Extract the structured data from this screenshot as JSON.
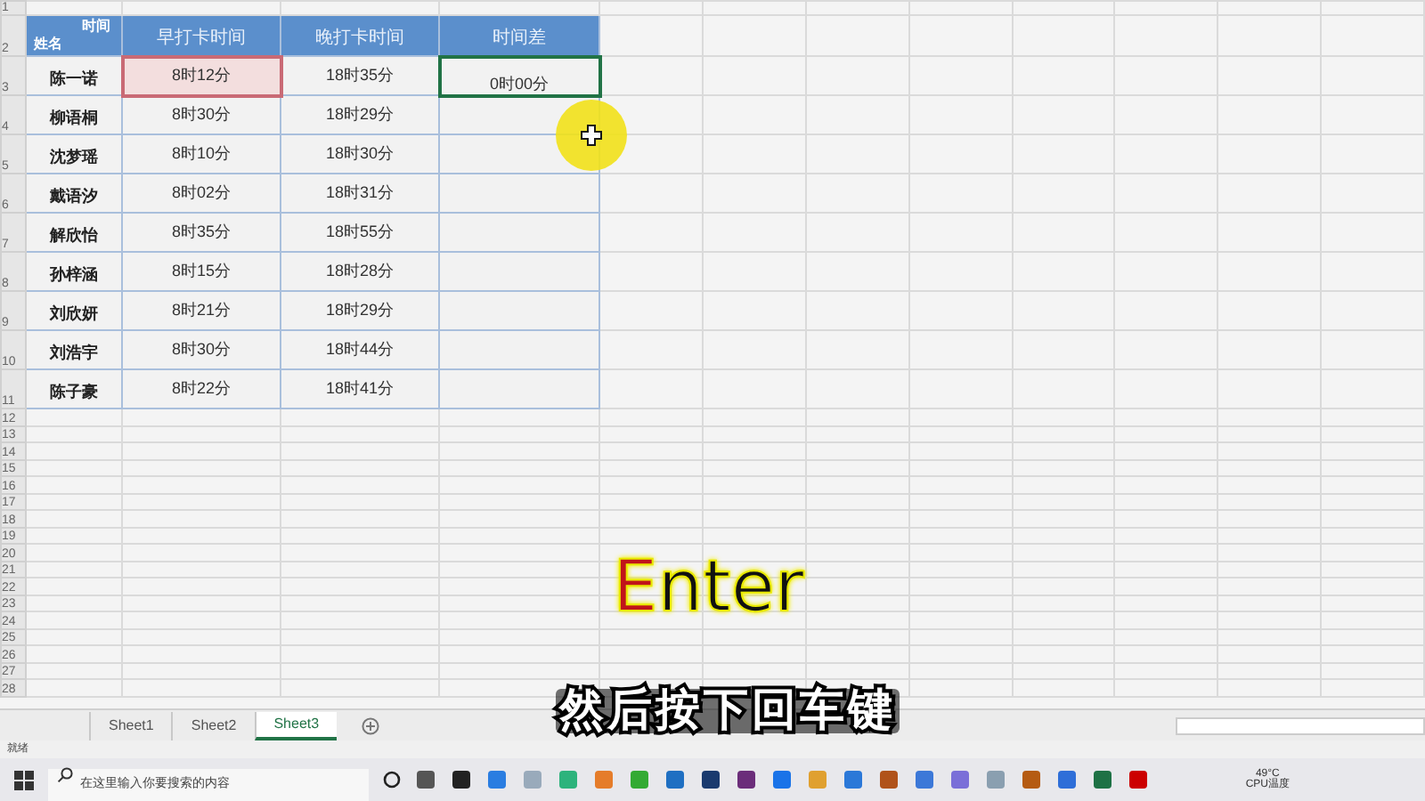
{
  "sheet": {
    "corner_header": {
      "top": "时间",
      "bottom": "姓名"
    },
    "columns": [
      "早打卡时间",
      "晚打卡时间",
      "时间差"
    ],
    "rows": [
      {
        "name": "陈一诺",
        "cells": [
          {
            "text": "8时12分",
            "kind": "referenced"
          },
          {
            "text": "18时35分",
            "kind": "plain"
          },
          {
            "text": "0时00分",
            "kind": "selected"
          }
        ]
      },
      {
        "name": "柳语桐",
        "cells": [
          {
            "text": "8时30分",
            "kind": "plain"
          },
          {
            "text": "18时29分",
            "kind": "plain"
          },
          {
            "kind": "plain"
          }
        ]
      },
      {
        "name": "沈梦瑶",
        "cells": [
          {
            "text": "8时10分",
            "kind": "plain"
          },
          {
            "text": "18时30分",
            "kind": "plain"
          },
          {
            "kind": "plain"
          }
        ]
      },
      {
        "name": "戴语汐",
        "cells": [
          {
            "text": "8时02分",
            "kind": "plain"
          },
          {
            "text": "18时31分",
            "kind": "plain"
          },
          {
            "kind": "plain"
          }
        ]
      },
      {
        "name": "解欣怡",
        "cells": [
          {
            "text": "8时35分",
            "kind": "plain"
          },
          {
            "text": "18时55分",
            "kind": "plain"
          },
          {
            "kind": "plain"
          }
        ]
      },
      {
        "name": "孙梓涵",
        "cells": [
          {
            "text": "8时15分",
            "kind": "plain"
          },
          {
            "text": "18时28分",
            "kind": "plain"
          },
          {
            "kind": "plain"
          }
        ]
      },
      {
        "name": "刘欣妍",
        "cells": [
          {
            "text": "8时21分",
            "kind": "plain"
          },
          {
            "text": "18时29分",
            "kind": "plain"
          },
          {
            "kind": "plain"
          }
        ]
      },
      {
        "name": "刘浩宇",
        "cells": [
          {
            "text": "8时30分",
            "kind": "plain"
          },
          {
            "text": "18时44分",
            "kind": "plain"
          },
          {
            "kind": "plain"
          }
        ]
      },
      {
        "name": "陈子豪",
        "cells": [
          {
            "text": "8时22分",
            "kind": "plain"
          },
          {
            "text": "18时41分",
            "kind": "plain"
          },
          {
            "kind": "plain"
          }
        ]
      }
    ],
    "row_numbers": [
      "1",
      "2",
      "3",
      "4",
      "5",
      "6",
      "7",
      "8",
      "9",
      "10",
      "11",
      "12",
      "13",
      "14",
      "15",
      "16",
      "17",
      "18",
      "19",
      "20",
      "21",
      "22",
      "23",
      "24",
      "25",
      "26",
      "27",
      "28"
    ]
  },
  "sheet_tabs": [
    {
      "label": "Sheet1",
      "selected": false
    },
    {
      "label": "Sheet2",
      "selected": false
    },
    {
      "label": "Sheet3",
      "selected": true
    }
  ],
  "status_bar": "就绪",
  "caption": {
    "key": "Enter",
    "subtitle": "然后按下回车键"
  },
  "taskbar": {
    "search": {
      "placeholder": "在这里输入你要搜索的内容"
    },
    "tray": {
      "temperature": "49°C",
      "label": "CPU温度"
    }
  }
}
